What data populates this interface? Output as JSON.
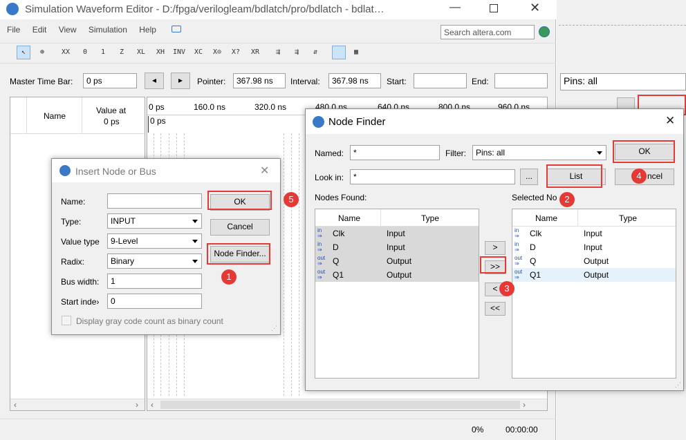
{
  "main_window": {
    "title": "Simulation Waveform Editor - D:/fpga/verilogleam/bdlatch/pro/bdlatch - bdlat…",
    "menu": [
      "File",
      "Edit",
      "View",
      "Simulation",
      "Help"
    ],
    "search_placeholder": "Search altera.com",
    "master_time_bar_label": "Master Time Bar:",
    "master_time_bar_value": "0 ps",
    "pointer_label": "Pointer:",
    "pointer_value": "367.98 ns",
    "interval_label": "Interval:",
    "interval_value": "367.98 ns",
    "start_label": "Start:",
    "end_label": "End:",
    "col_name": "Name",
    "col_value_at": "Value at",
    "col_value_at_time": "0 ps",
    "timeline_ticks": [
      "0 ps",
      "160.0 ns",
      "320.0 ns",
      "480.0 ns",
      "640.0 ns",
      "800.0 ns",
      "960.0 ns"
    ],
    "timeline_marker": "0 ps",
    "status_percent": "0%",
    "status_time": "00:00:00"
  },
  "background_window": {
    "filter_label": "Pins: all"
  },
  "insert_node_dialog": {
    "title": "Insert Node or Bus",
    "name_label": "Name:",
    "name_value": "",
    "type_label": "Type:",
    "type_value": "INPUT",
    "value_type_label": "Value type",
    "value_type_value": "9-Level",
    "radix_label": "Radix:",
    "radix_value": "Binary",
    "bus_width_label": "Bus width:",
    "bus_width_value": "1",
    "start_index_label": "Start inde›",
    "start_index_value": "0",
    "gray_code_label": "Display gray code count as binary count",
    "ok_label": "OK",
    "cancel_label": "Cancel",
    "node_finder_label": "Node Finder..."
  },
  "node_finder": {
    "title": "Node Finder",
    "named_label": "Named:",
    "named_value": "*",
    "filter_label": "Filter:",
    "filter_value": "Pins: all",
    "look_in_label": "Look in:",
    "look_in_value": "*",
    "browse_label": "...",
    "list_label": "List",
    "ok_label": "OK",
    "cancel_label": "ncel",
    "nodes_found_label": "Nodes Found:",
    "selected_nodes_label": "Selected No",
    "col_name": "Name",
    "col_type": "Type",
    "move_one": ">",
    "move_all": ">>",
    "remove_one": "<",
    "remove_all": "<<",
    "found": [
      {
        "icon": "in",
        "name": "Clk",
        "type": "Input"
      },
      {
        "icon": "in",
        "name": "D",
        "type": "Input"
      },
      {
        "icon": "out",
        "name": "Q",
        "type": "Output"
      },
      {
        "icon": "out",
        "name": "Q1",
        "type": "Output"
      }
    ],
    "selected": [
      {
        "icon": "in",
        "name": "Clk",
        "type": "Input"
      },
      {
        "icon": "in",
        "name": "D",
        "type": "Input"
      },
      {
        "icon": "out",
        "name": "Q",
        "type": "Output"
      },
      {
        "icon": "out",
        "name": "Q1",
        "type": "Output"
      }
    ]
  },
  "badges": [
    "1",
    "2",
    "3",
    "4",
    "5"
  ],
  "colors": {
    "highlight_red": "#e53935",
    "selection_gray": "#d9d9d9",
    "selection_blue": "#e5f1fb"
  }
}
